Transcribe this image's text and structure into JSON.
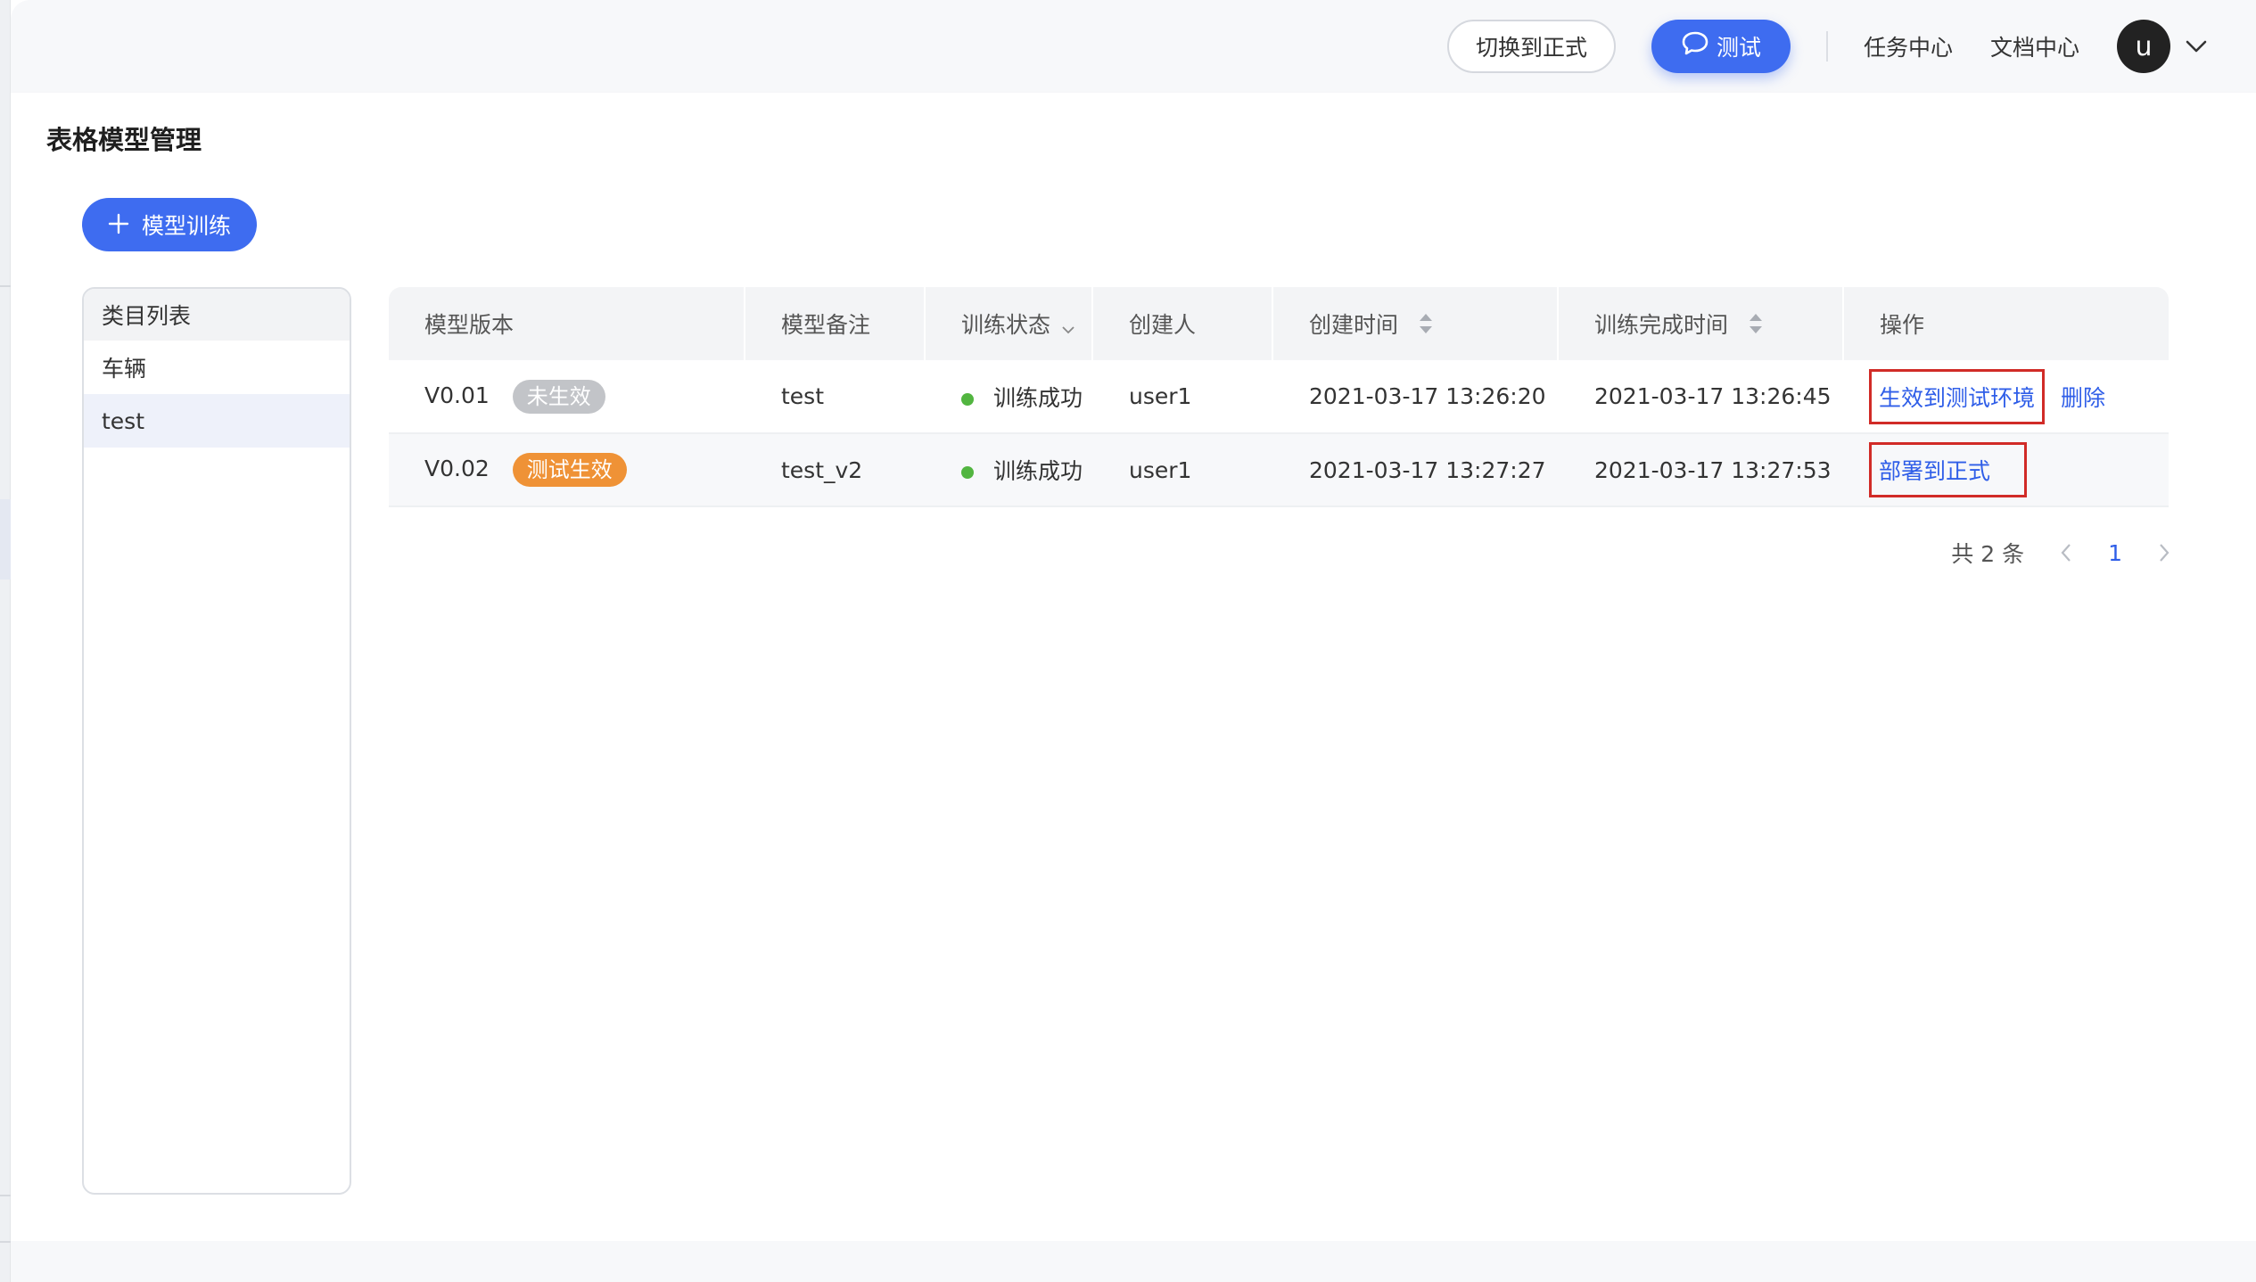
{
  "topbar": {
    "switch_button": "切换到正式",
    "test_button": "测试",
    "task_center": "任务中心",
    "doc_center": "文档中心",
    "avatar_letter": "u"
  },
  "page": {
    "title": "表格模型管理"
  },
  "toolbar": {
    "train_button": "模型训练"
  },
  "categories": {
    "header": "类目列表",
    "items": [
      {
        "label": "车辆",
        "selected": false
      },
      {
        "label": "test",
        "selected": true
      }
    ]
  },
  "table": {
    "columns": [
      "模型版本",
      "模型备注",
      "训练状态",
      "创建人",
      "创建时间",
      "训练完成时间",
      "操作"
    ],
    "rows": [
      {
        "version": "V0.01",
        "tag": "未生效",
        "remark": "test",
        "status": "训练成功",
        "creator": "user1",
        "created_at": "2021-03-17 13:26:20",
        "finished_at": "2021-03-17 13:26:45",
        "action_primary": "生效到测试环境",
        "action_secondary": "删除"
      },
      {
        "version": "V0.02",
        "tag": "测试生效",
        "remark": "test_v2",
        "status": "训练成功",
        "creator": "user1",
        "created_at": "2021-03-17 13:27:27",
        "finished_at": "2021-03-17 13:27:53",
        "action_primary": "部署到正式"
      }
    ]
  },
  "pagination": {
    "total_text": "共 2 条",
    "current_page": "1"
  },
  "colors": {
    "primary": "#3e6cf0",
    "link": "#2f5ee8",
    "success_dot": "#52b540",
    "tag_inactive": "#c2c4c8",
    "tag_test": "#ef9236",
    "highlight_box": "#d12b27"
  },
  "icons": [
    "chat-icon",
    "chevron-down-icon",
    "plus-icon",
    "filter-chevron-icon",
    "sort-icon",
    "prev-page-icon",
    "next-page-icon"
  ]
}
